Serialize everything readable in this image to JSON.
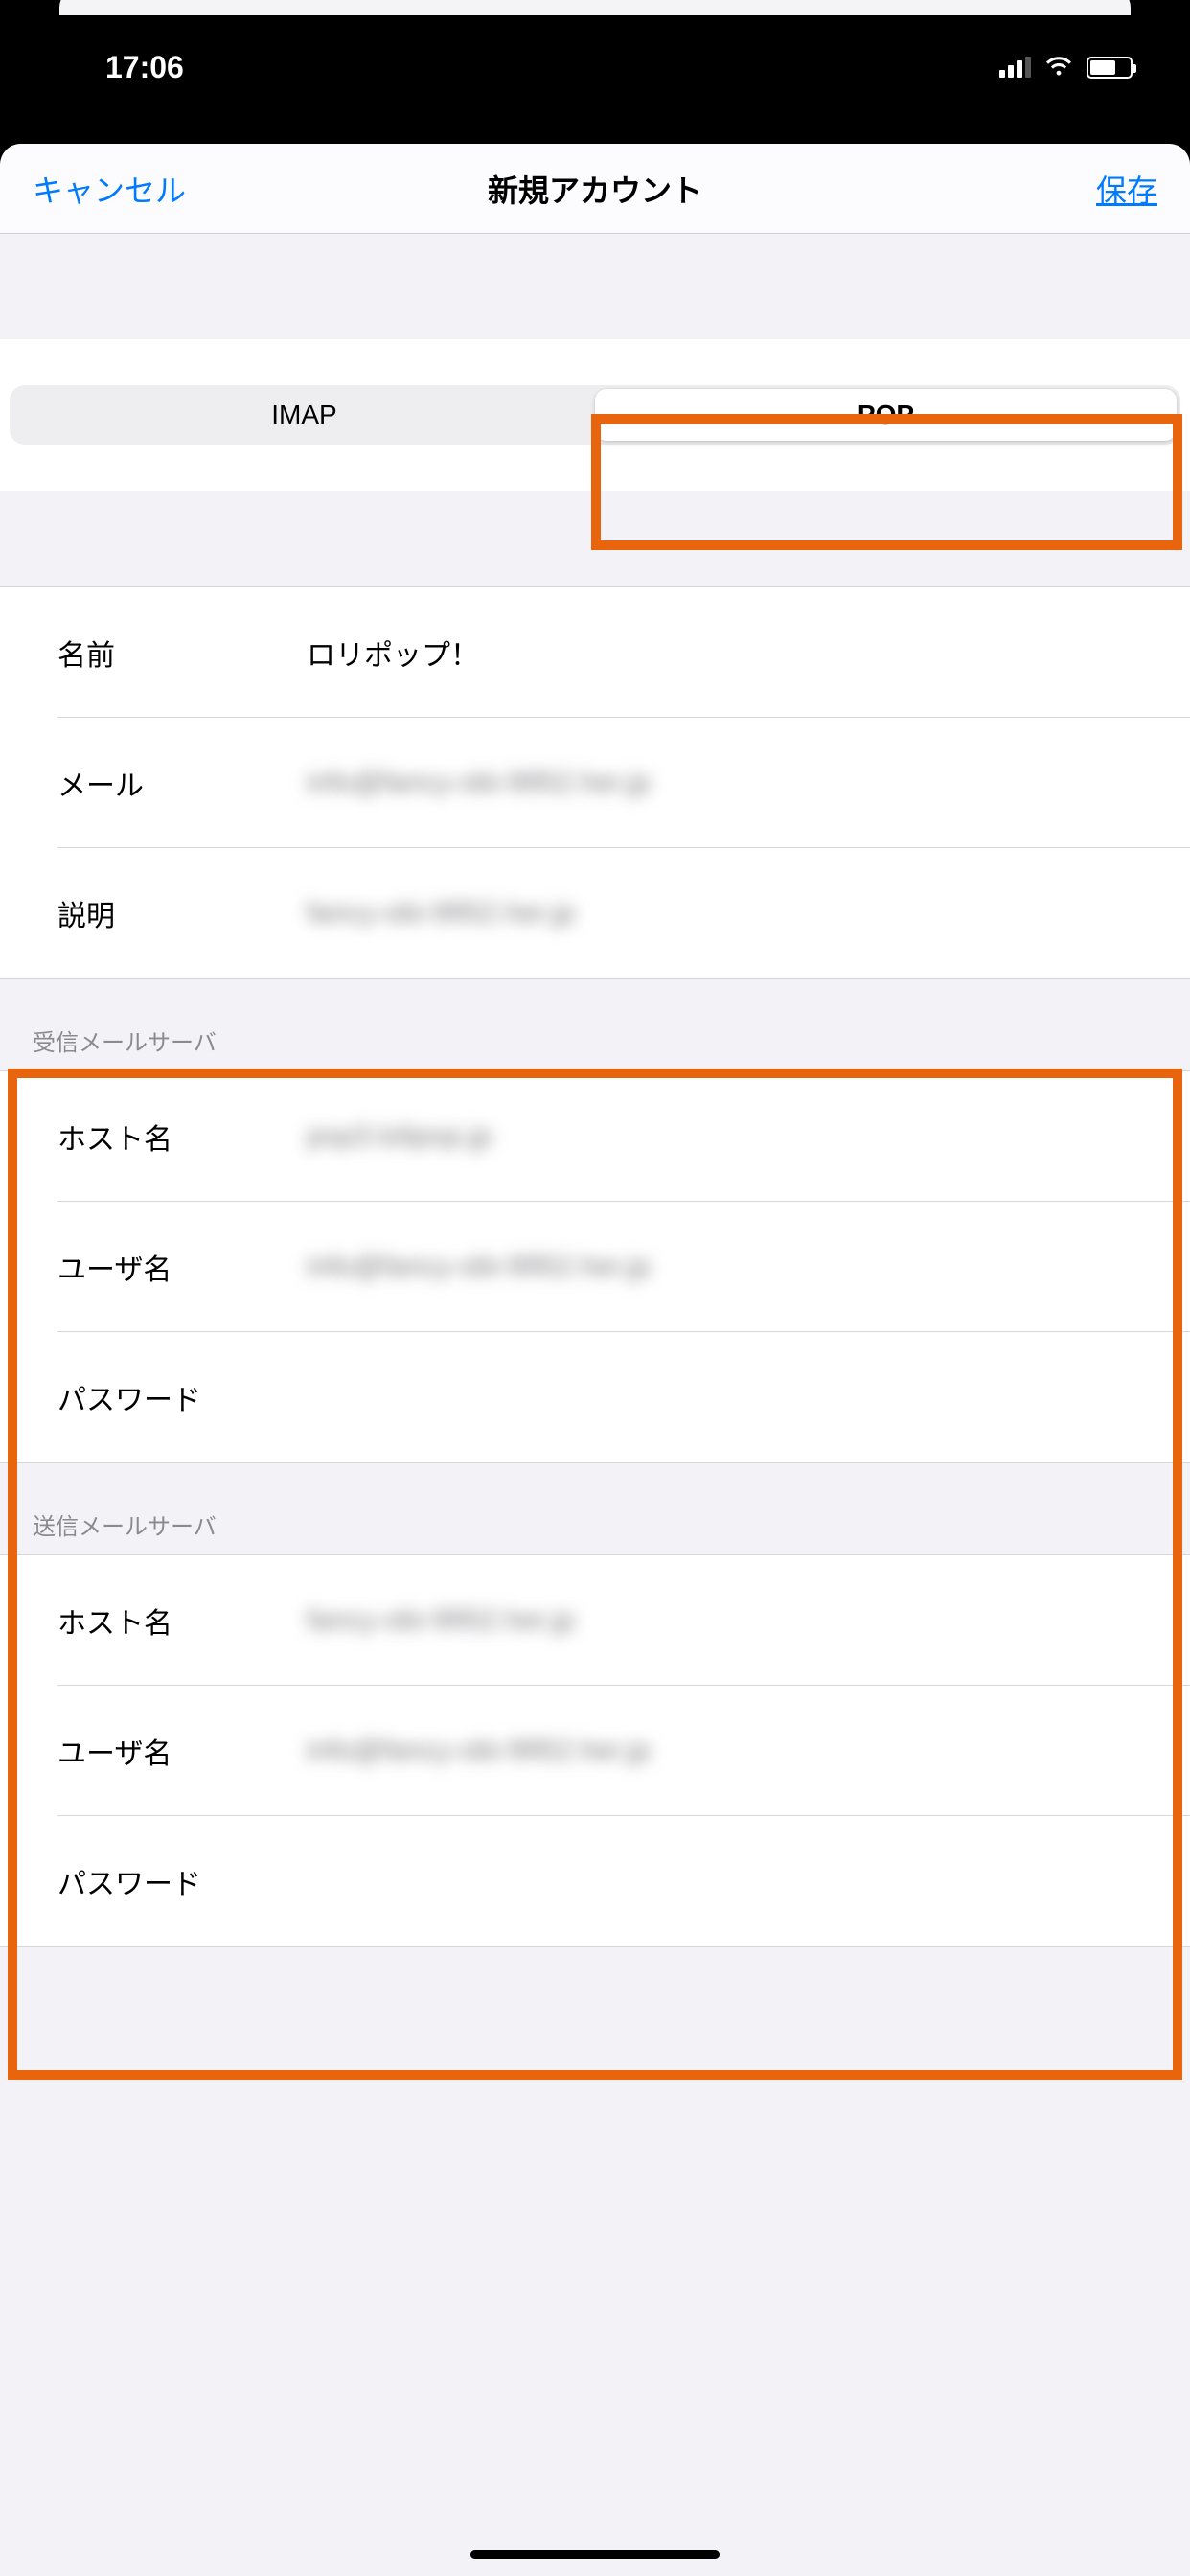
{
  "statusbar": {
    "time": "17:06"
  },
  "nav": {
    "cancel": "キャンセル",
    "title": "新規アカウント",
    "save": "保存"
  },
  "segmented": {
    "imap": "IMAP",
    "pop": "POP",
    "selected": "POP"
  },
  "account": {
    "name_label": "名前",
    "name_value": "ロリポップ！",
    "email_label": "メール",
    "email_value": "info@fancy-obi-9952.her.jp",
    "desc_label": "説明",
    "desc_value": "fancy-obi-9952.her.jp"
  },
  "incoming": {
    "header": "受信メールサーバ",
    "host_label": "ホスト名",
    "host_value": "pop3.lolipop.jp",
    "user_label": "ユーザ名",
    "user_value": "info@fancy-obi-9952.her.jp",
    "pass_label": "パスワード",
    "pass_value": ""
  },
  "outgoing": {
    "header": "送信メールサーバ",
    "host_label": "ホスト名",
    "host_value": "fancy-obi-9952.her.jp",
    "user_label": "ユーザ名",
    "user_value": "info@fancy-obi-9952.her.jp",
    "pass_label": "パスワード",
    "pass_value": ""
  },
  "highlight_color": "#e8650d"
}
